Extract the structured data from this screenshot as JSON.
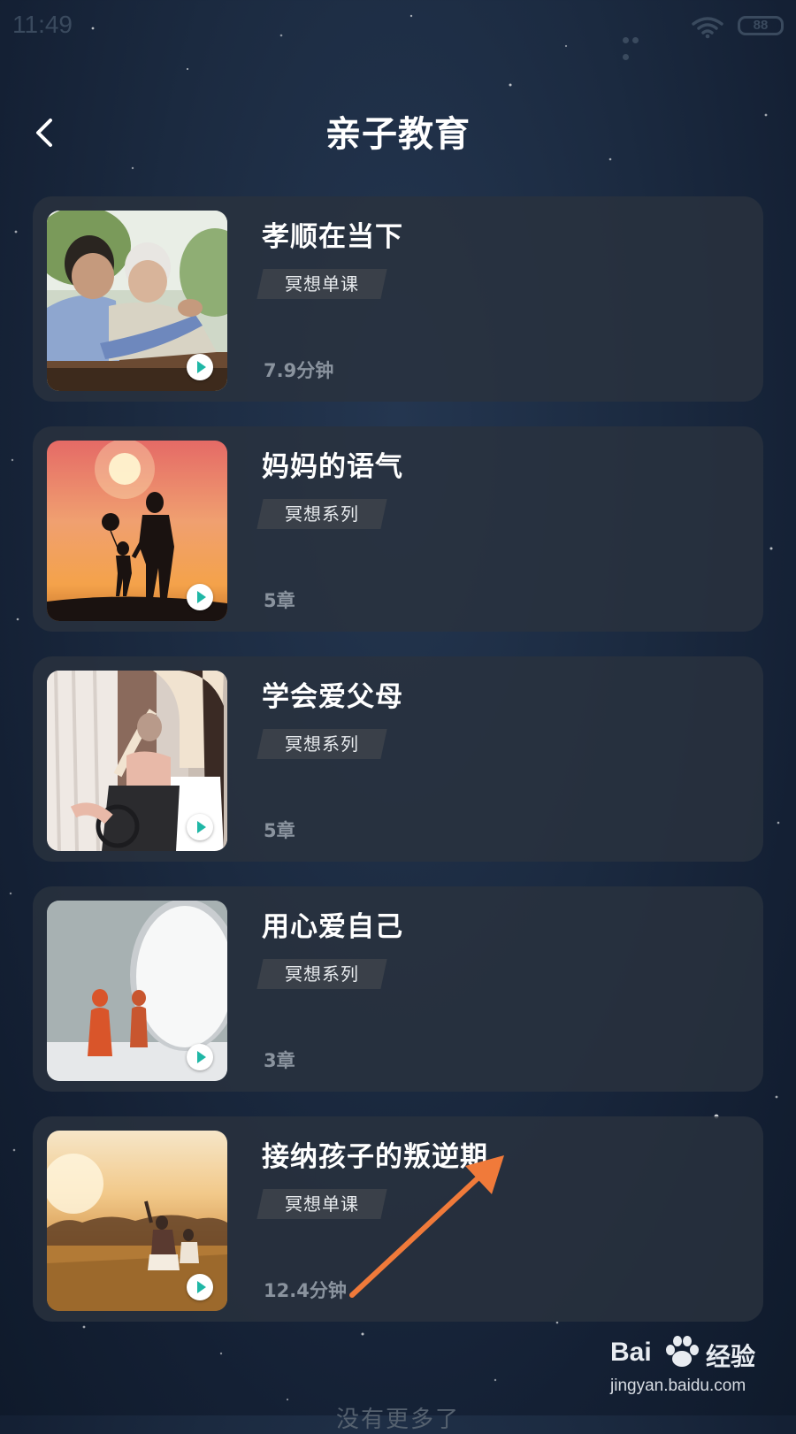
{
  "status_bar": {
    "time": "11:49",
    "battery": "88"
  },
  "header": {
    "title": "亲子教育",
    "back_icon": "chevron-left-icon"
  },
  "courses": [
    {
      "title": "孝顺在当下",
      "tag": "冥想单课",
      "meta": "7.9分钟",
      "thumbnail": "son-and-father-on-bench"
    },
    {
      "title": "妈妈的语气",
      "tag": "冥想系列",
      "meta": "5章",
      "thumbnail": "mother-child-balloon-sunset"
    },
    {
      "title": "学会爱父母",
      "tag": "冥想系列",
      "meta": "5章",
      "thumbnail": "caregiver-with-wheelchair"
    },
    {
      "title": "用心爱自己",
      "tag": "冥想系列",
      "meta": "3章",
      "thumbnail": "figure-and-mirror"
    },
    {
      "title": "接纳孩子的叛逆期",
      "tag": "冥想单课",
      "meta": "12.4分钟",
      "thumbnail": "child-in-golden-field"
    }
  ],
  "footer": {
    "text": "没有更多了"
  },
  "watermark": {
    "brand": "Bai",
    "brand_cn": "经验",
    "url": "jingyan.baidu.com"
  },
  "colors": {
    "background": "#1b2a40",
    "card": "#2a323e",
    "tag": "#3a4049",
    "meta": "#8a939e",
    "play_accent": "#1fb7a6",
    "annotation_arrow": "#f07a3a"
  }
}
